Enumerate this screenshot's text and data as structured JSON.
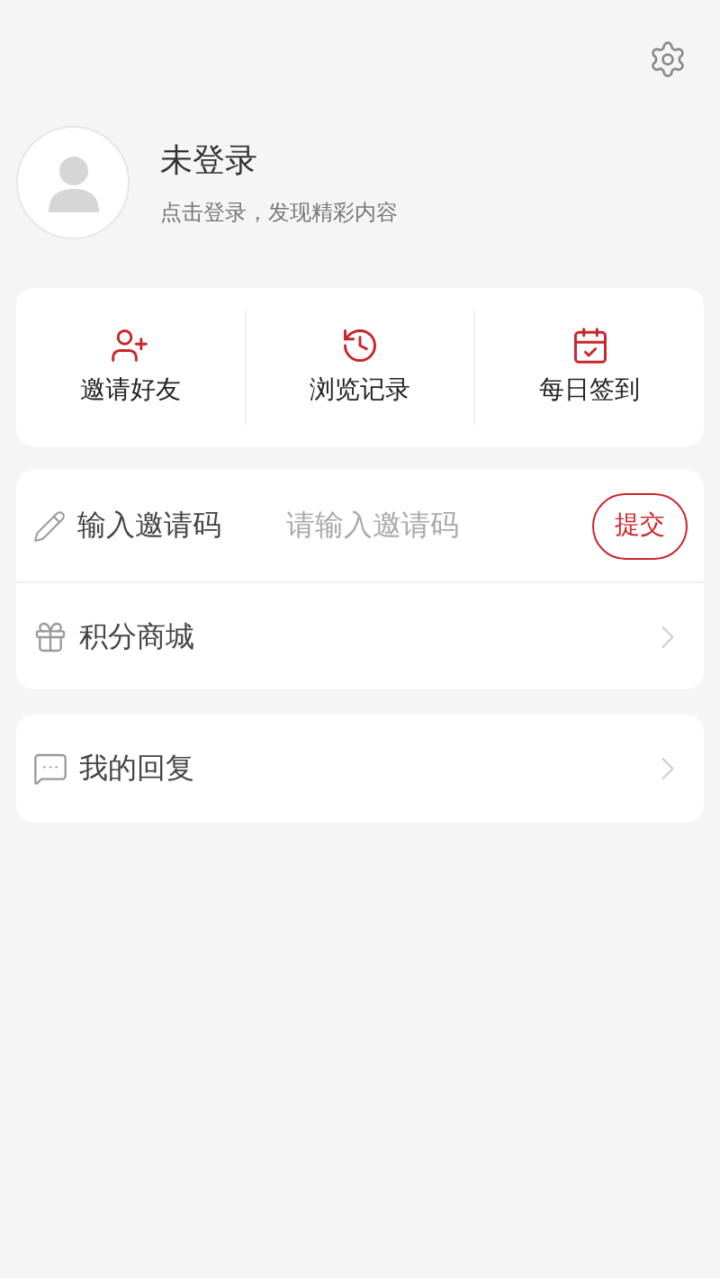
{
  "profile": {
    "name": "未登录",
    "subtitle": "点击登录，发现精彩内容"
  },
  "shortcuts": [
    {
      "kind": "invite",
      "label": "邀请好友"
    },
    {
      "kind": "history",
      "label": "浏览记录"
    },
    {
      "kind": "checkin",
      "label": "每日签到"
    }
  ],
  "invite_code": {
    "label": "输入邀请码",
    "placeholder": "请输入邀请码",
    "button": "提交"
  },
  "menu": [
    {
      "kind": "gift",
      "label": "积分商城"
    }
  ],
  "menu2": [
    {
      "kind": "reply",
      "label": "我的回复"
    }
  ]
}
